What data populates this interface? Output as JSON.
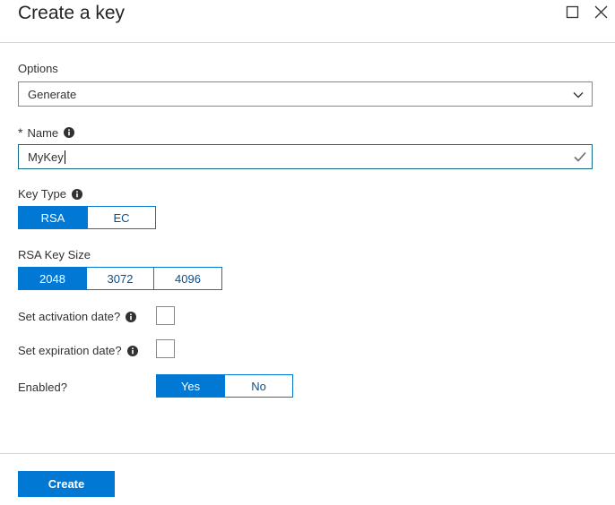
{
  "header": {
    "title": "Create a key"
  },
  "options": {
    "label": "Options",
    "selected": "Generate"
  },
  "name": {
    "required_marker": "*",
    "label": "Name",
    "value": "MyKey"
  },
  "key_type": {
    "label": "Key Type",
    "options": [
      "RSA",
      "EC"
    ],
    "selected": "RSA"
  },
  "rsa_key_size": {
    "label": "RSA Key Size",
    "options": [
      "2048",
      "3072",
      "4096"
    ],
    "selected": "2048"
  },
  "activation": {
    "label": "Set activation date?",
    "checked": false
  },
  "expiration": {
    "label": "Set expiration date?",
    "checked": false
  },
  "enabled": {
    "label": "Enabled?",
    "options": [
      "Yes",
      "No"
    ],
    "selected": "Yes"
  },
  "footer": {
    "create_label": "Create"
  },
  "colors": {
    "accent": "#0078d4",
    "valid": "#107c10"
  },
  "icons": [
    "maximize-icon",
    "close-icon",
    "chevron-down-icon",
    "info-icon",
    "checkmark-icon"
  ]
}
